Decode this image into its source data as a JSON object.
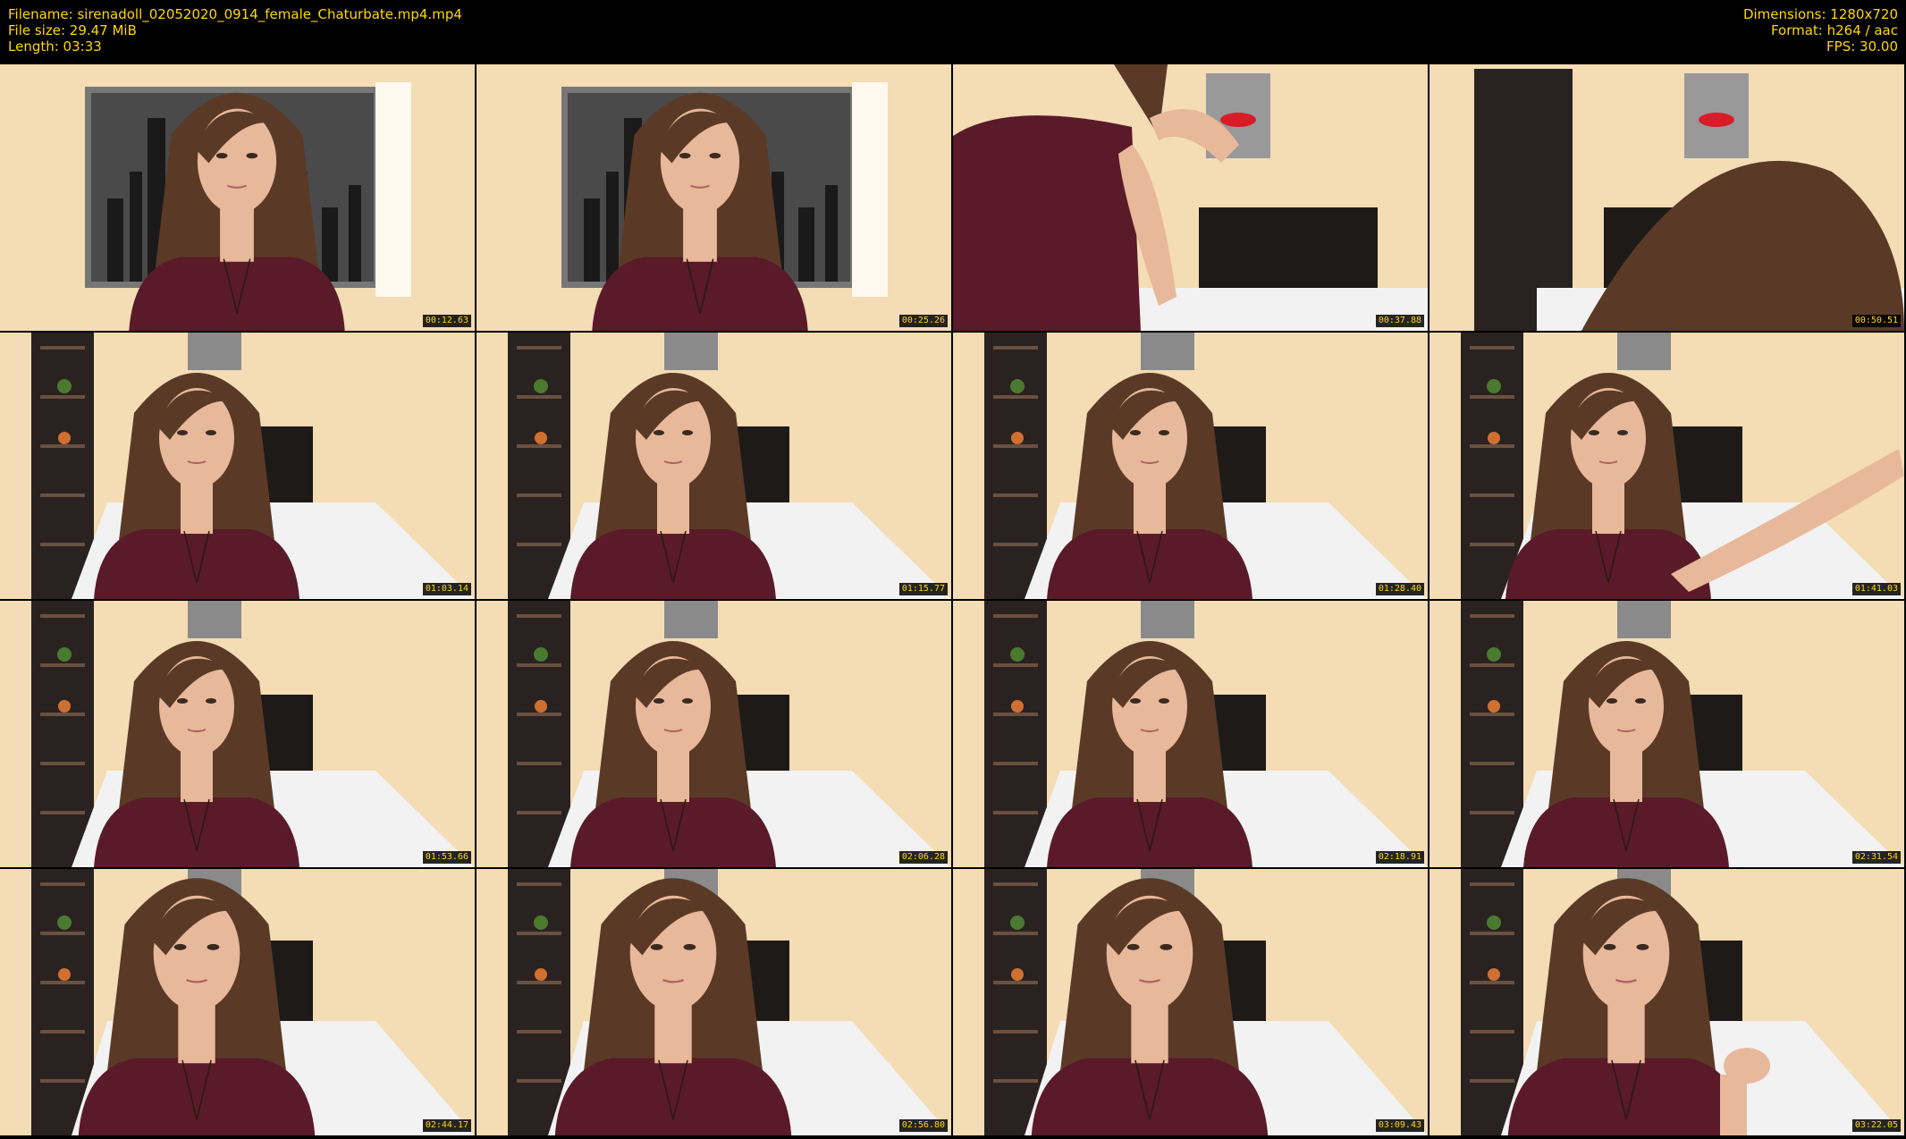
{
  "header": {
    "filename": "Filename: sirenadoll_02052020_0914_female_Chaturbate.mp4.mp4",
    "file_size": "File size: 29.47 MiB",
    "length": "Length: 03:33",
    "dimensions": "Dimensions: 1280x720",
    "format": "Format: h264 / aac",
    "fps": "FPS: 30.00"
  },
  "colors": {
    "text": "#ffd700",
    "background": "#000000",
    "wall": "#f4dcb4",
    "top": "#5a1a2a",
    "hair": "#5a3a26",
    "skin": "#e8b89a",
    "headboard": "#1e1a18",
    "bedsheet": "#f2f2f2",
    "shelf": "#2a2220",
    "red_accent": "#d81c28"
  },
  "thumbnails": [
    {
      "timestamp": "00:12.63",
      "scene": "city"
    },
    {
      "timestamp": "00:25.26",
      "scene": "city"
    },
    {
      "timestamp": "00:37.88",
      "scene": "closeup"
    },
    {
      "timestamp": "00:50.51",
      "scene": "lean"
    },
    {
      "timestamp": "01:03.14",
      "scene": "bed"
    },
    {
      "timestamp": "01:15.77",
      "scene": "bed"
    },
    {
      "timestamp": "01:28.40",
      "scene": "bed"
    },
    {
      "timestamp": "01:41.03",
      "scene": "bed-arm"
    },
    {
      "timestamp": "01:53.66",
      "scene": "bed"
    },
    {
      "timestamp": "02:06.28",
      "scene": "bed"
    },
    {
      "timestamp": "02:18.91",
      "scene": "bed"
    },
    {
      "timestamp": "02:31.54",
      "scene": "bed"
    },
    {
      "timestamp": "02:44.17",
      "scene": "bed-near"
    },
    {
      "timestamp": "02:56.80",
      "scene": "bed-near"
    },
    {
      "timestamp": "03:09.43",
      "scene": "bed-near"
    },
    {
      "timestamp": "03:22.05",
      "scene": "bed-hand"
    }
  ]
}
